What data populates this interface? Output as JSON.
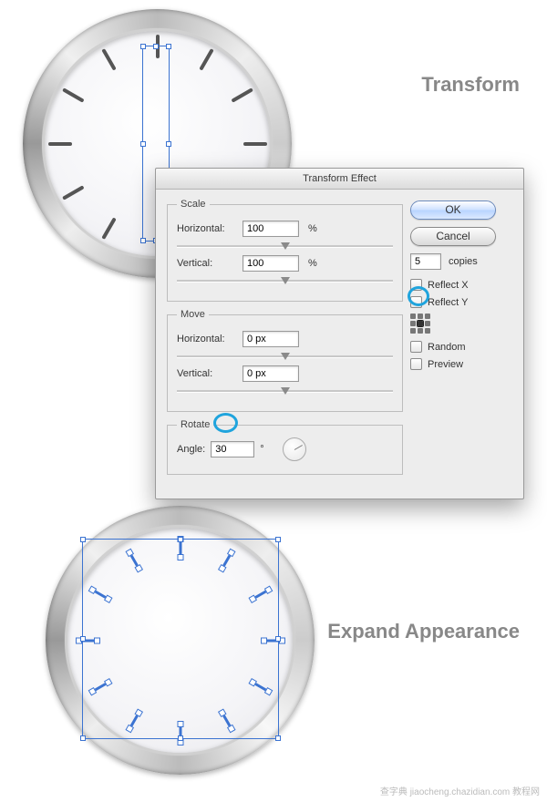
{
  "captions": {
    "transform": "Transform",
    "expand": "Expand Appearance"
  },
  "dialog": {
    "title": "Transform Effect",
    "scale": {
      "legend": "Scale",
      "horizontal_label": "Horizontal:",
      "horizontal_value": "100",
      "vertical_label": "Vertical:",
      "vertical_value": "100",
      "unit": "%"
    },
    "move": {
      "legend": "Move",
      "horizontal_label": "Horizontal:",
      "horizontal_value": "0 px",
      "vertical_label": "Vertical:",
      "vertical_value": "0 px"
    },
    "rotate": {
      "legend": "Rotate",
      "angle_label": "Angle:",
      "angle_value": "30",
      "unit": "°"
    },
    "buttons": {
      "ok": "OK",
      "cancel": "Cancel"
    },
    "copies_value": "5",
    "copies_label": "copies",
    "reflect_x": "Reflect X",
    "reflect_y": "Reflect Y",
    "random": "Random",
    "preview": "Preview"
  },
  "watermark": "查字典 jiaocheng.chazidian.com 教程网"
}
